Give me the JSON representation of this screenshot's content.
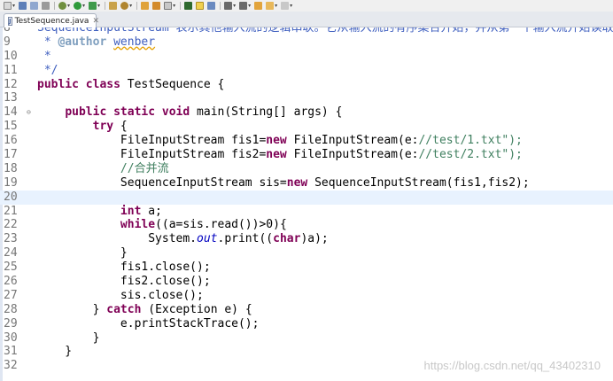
{
  "colors": {
    "keyword": "#7f0055",
    "string": "#2a00ff",
    "comment": "#3f7f5f",
    "javadoc": "#3f5fbf",
    "field": "#0000c0",
    "current_line": "#e8f2fe"
  },
  "toolbar": {
    "icons": [
      "new-icon",
      "save-icon",
      "save-all-icon",
      "print-icon",
      "debug-icon",
      "run-icon",
      "external-tools-icon",
      "new-java-project-icon",
      "new-package-icon",
      "new-class-icon",
      "open-type-icon",
      "search-icon",
      "mark-occurrences-icon",
      "next-annotation-icon",
      "prev-annotation-icon",
      "back-icon",
      "forward-icon"
    ]
  },
  "editor_tab": {
    "title": "TestSequence.java",
    "close": "✕"
  },
  "code": {
    "lines": [
      {
        "num": "8",
        "text": "SequenceInputStream 表示其他输入流的逻辑串联。它从输入流的有序集合开始，并从第一个输入流开始读取，直到到达文件"
      },
      {
        "num": "9",
        "text": " * @author wenber"
      },
      {
        "num": "10",
        "text": " *"
      },
      {
        "num": "11",
        "text": " */"
      },
      {
        "num": "12",
        "text": "public class TestSequence {"
      },
      {
        "num": "13",
        "text": ""
      },
      {
        "num": "14",
        "text": "    public static void main(String[] args) {"
      },
      {
        "num": "15",
        "text": "        try {"
      },
      {
        "num": "16",
        "text": "            FileInputStream fis1=new FileInputStream(\"e://test/1.txt\");"
      },
      {
        "num": "17",
        "text": "            FileInputStream fis2=new FileInputStream(\"e://test/2.txt\");"
      },
      {
        "num": "18",
        "text": "            //合并流"
      },
      {
        "num": "19",
        "text": "            SequenceInputStream sis=new SequenceInputStream(fis1,fis2);"
      },
      {
        "num": "20",
        "text": ""
      },
      {
        "num": "21",
        "text": "            int a;"
      },
      {
        "num": "22",
        "text": "            while((a=sis.read())>0){"
      },
      {
        "num": "23",
        "text": "                System.out.print((char)a);"
      },
      {
        "num": "24",
        "text": "            }"
      },
      {
        "num": "25",
        "text": "            fis1.close();"
      },
      {
        "num": "26",
        "text": "            fis2.close();"
      },
      {
        "num": "27",
        "text": "            sis.close();"
      },
      {
        "num": "28",
        "text": "        } catch (Exception e) {"
      },
      {
        "num": "29",
        "text": "            e.printStackTrace();"
      },
      {
        "num": "30",
        "text": "        }"
      },
      {
        "num": "31",
        "text": "    }"
      },
      {
        "num": "32",
        "text": ""
      }
    ],
    "current_line": "20",
    "fold_marker_line": "14"
  },
  "watermark": "https://blog.csdn.net/qq_43402310"
}
